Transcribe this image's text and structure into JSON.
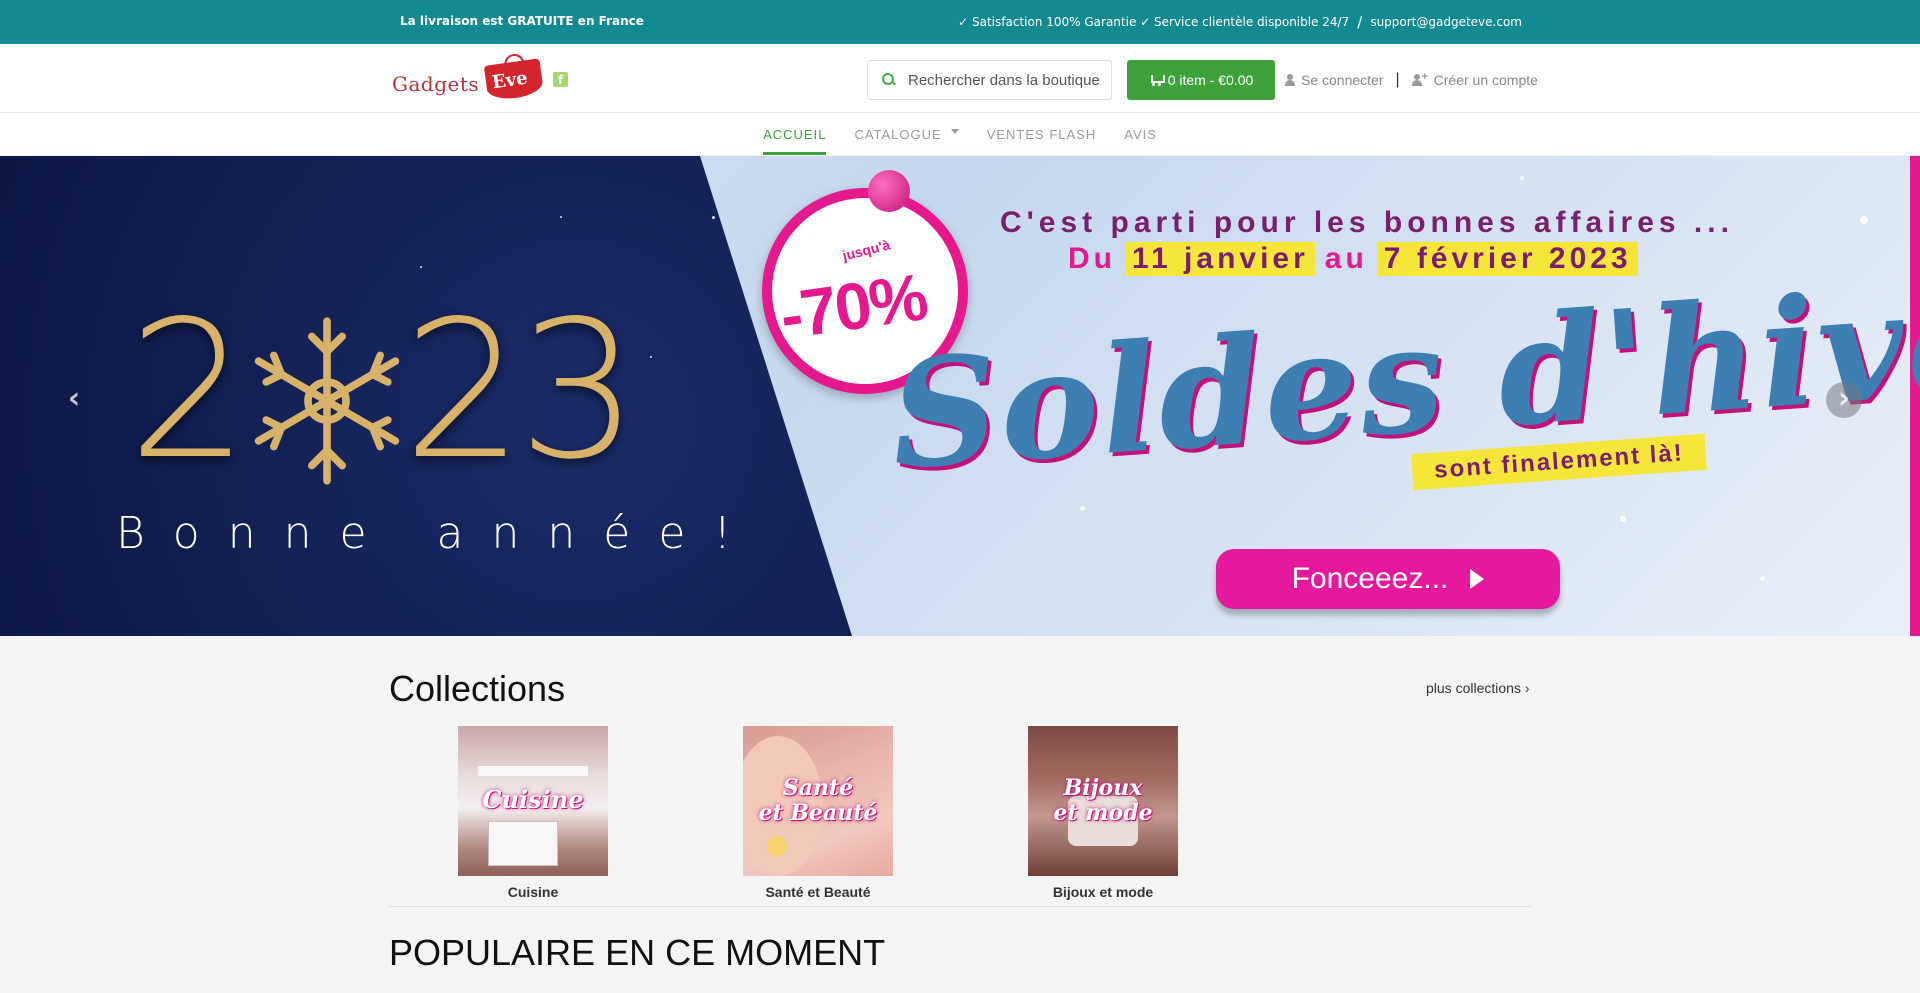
{
  "topbar": {
    "left": "La livraison est GRATUITE en France",
    "right": "✓ Satisfaction 100% Garantie ✓ Service clientèle disponible 24/7",
    "sep": "/",
    "email": "support@gadgeteve.com",
    "bg": "#138a92"
  },
  "header": {
    "logo_text": "Gadgets D",
    "logo_bag": "Eve",
    "fb_icon": "facebook-icon",
    "search_placeholder": "Rechercher dans la boutique",
    "cart_label": "0 item - €0.00",
    "login": "Se connecter",
    "sep": "|",
    "register": "Créer un compte"
  },
  "nav": {
    "items": [
      {
        "label": "ACCUEIL"
      },
      {
        "label": "CATALOGUE"
      },
      {
        "label": "VENTES FLASH"
      },
      {
        "label": "AVIS"
      }
    ],
    "accent": "#3ea23c"
  },
  "banner": {
    "year_left": "2",
    "year_right": "23",
    "bonne": "Bonne année!",
    "badge_small": "jusqu'à",
    "badge_pct": "-70%",
    "headline": "C'est parti pour les bonnes affaires ...",
    "dates_du": "Du",
    "dates_start": "11 janvier",
    "dates_au": "au",
    "dates_end": "7 février 2023",
    "soldes": "Soldes d'hiver",
    "sont": "sont finalement là!",
    "cta": "Fonceeez...",
    "prev": "‹",
    "next": "›",
    "pink": "#e5188e"
  },
  "collections": {
    "title": "Collections",
    "more": "plus collections ›",
    "items": [
      {
        "img_label": "Cuisine",
        "caption": "Cuisine"
      },
      {
        "img_label1": "Santé",
        "img_label2": "et Beauté",
        "caption": "Santé et Beauté"
      },
      {
        "img_label1": "Bijoux",
        "img_label2": "et mode",
        "caption": "Bijoux et mode"
      }
    ]
  },
  "popular": {
    "title": "POPULAIRE EN CE MOMENT"
  }
}
